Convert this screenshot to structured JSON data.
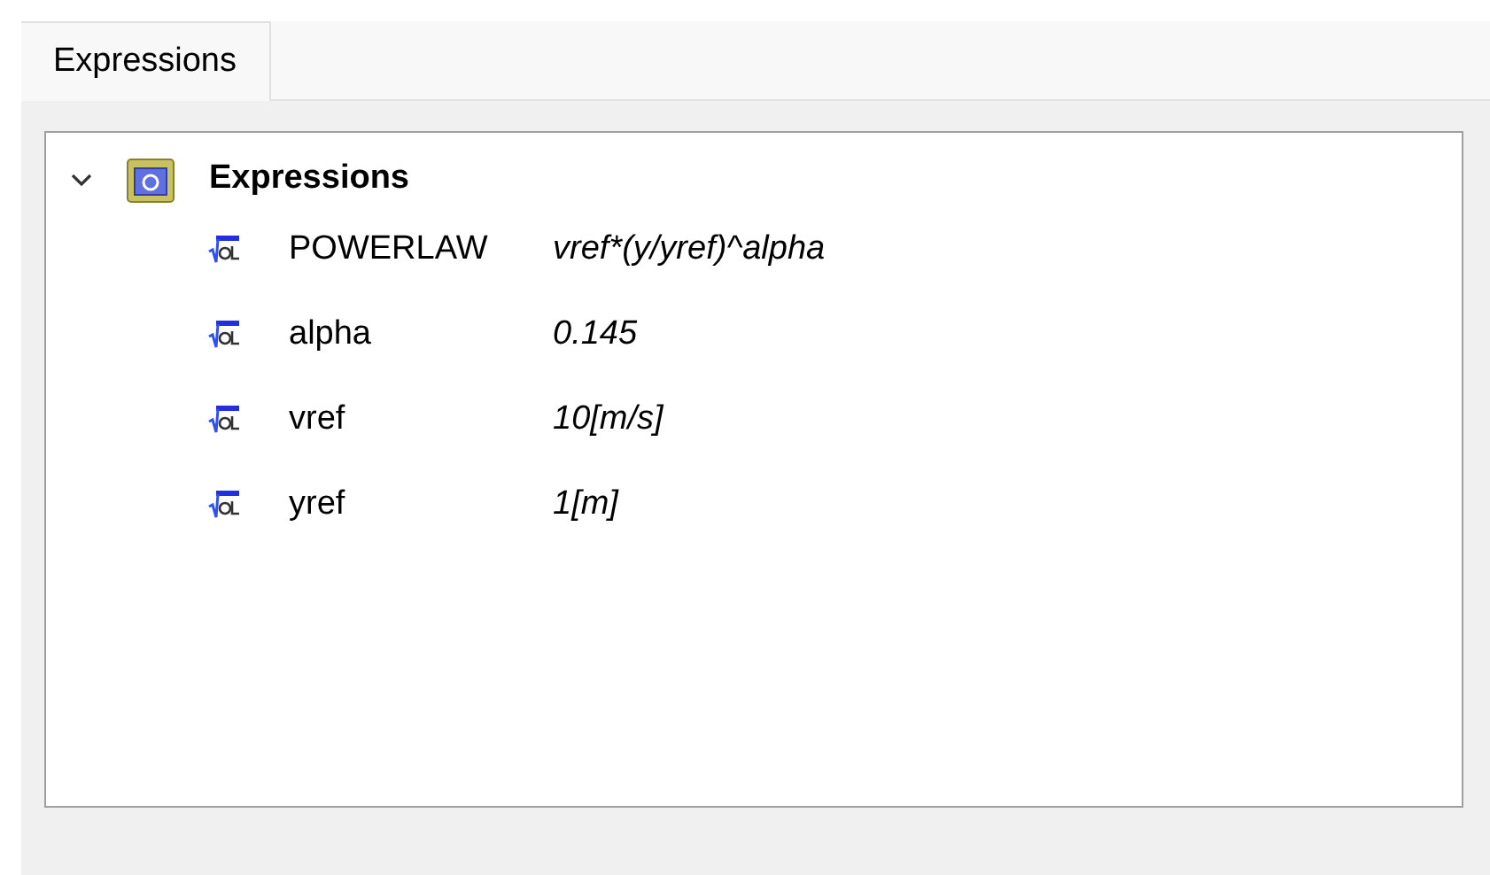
{
  "tabs": [
    {
      "label": "Expressions",
      "selected": true
    }
  ],
  "tree": {
    "label": "Expressions",
    "expanded": true,
    "children": [
      {
        "name": "POWERLAW",
        "value": "vref*(y/yref)^alpha"
      },
      {
        "name": "alpha",
        "value": "0.145"
      },
      {
        "name": "vref",
        "value": "10[m/s]"
      },
      {
        "name": "yref",
        "value": "1[m]"
      }
    ]
  }
}
